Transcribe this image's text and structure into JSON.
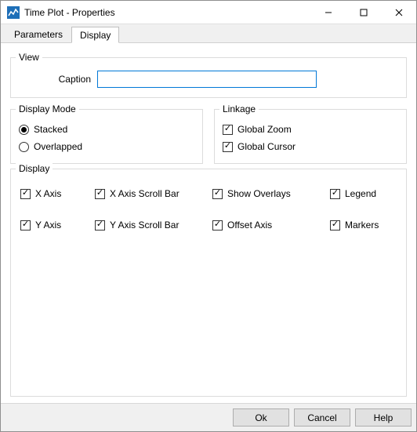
{
  "window": {
    "title": "Time Plot - Properties"
  },
  "tabs": {
    "parameters": "Parameters",
    "display": "Display"
  },
  "groups": {
    "view": "View",
    "display_mode": "Display Mode",
    "linkage": "Linkage",
    "display": "Display"
  },
  "view": {
    "caption_label": "Caption",
    "caption_value": ""
  },
  "display_mode": {
    "stacked": "Stacked",
    "overlapped": "Overlapped",
    "selected": "stacked"
  },
  "linkage": {
    "global_zoom": "Global Zoom",
    "global_cursor": "Global Cursor"
  },
  "display": {
    "x_axis": "X Axis",
    "x_axis_scroll": "X Axis Scroll Bar",
    "show_overlays": "Show Overlays",
    "legend": "Legend",
    "y_axis": "Y Axis",
    "y_axis_scroll": "Y Axis Scroll Bar",
    "offset_axis": "Offset Axis",
    "markers": "Markers"
  },
  "buttons": {
    "ok": "Ok",
    "cancel": "Cancel",
    "help": "Help"
  }
}
